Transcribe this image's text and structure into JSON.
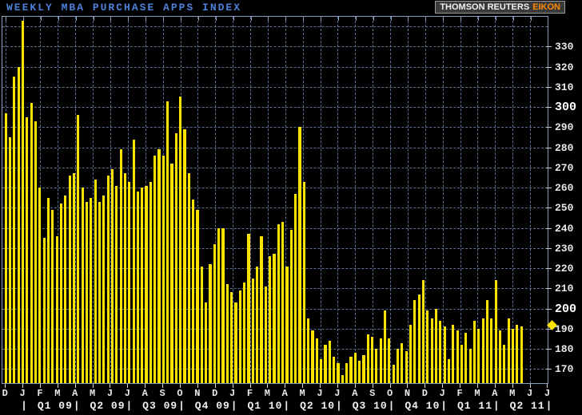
{
  "title_bar": {
    "title": "WEEKLY MBA PURCHASE APPS INDEX",
    "brand": {
      "name": "THOMSON REUTERS",
      "product": "EIKON"
    }
  },
  "chart_data": {
    "type": "bar",
    "title": "WEEKLY MBA PURCHASE APPS INDEX",
    "grid": "dashed",
    "legend_position": "none",
    "ylim": [
      164,
      345
    ],
    "y_ticks": [
      330,
      320,
      310,
      300,
      290,
      280,
      270,
      260,
      250,
      240,
      230,
      220,
      210,
      200,
      190,
      180,
      170
    ],
    "y_ticks_emphasized": [
      300,
      200
    ],
    "y_gridlines": [
      340,
      330,
      320,
      310,
      300,
      290,
      280,
      270,
      260,
      250,
      240,
      230,
      220,
      210,
      200,
      190,
      180,
      170
    ],
    "x_month_labels": [
      "D",
      "J",
      "F",
      "M",
      "A",
      "M",
      "J",
      "J",
      "A",
      "S",
      "O",
      "N",
      "D",
      "J",
      "F",
      "M",
      "A",
      "M",
      "J",
      "J",
      "A",
      "S",
      "O",
      "N",
      "D",
      "J",
      "F",
      "M",
      "A",
      "M",
      "J",
      "J"
    ],
    "x_quarter_labels": [
      "Q1 09",
      "Q2 09",
      "Q3 09",
      "Q4 09",
      "Q1 10",
      "Q2 10",
      "Q3 10",
      "Q4 10",
      "Q1 11",
      "Q2 11"
    ],
    "values": [
      298,
      286,
      316,
      321,
      344,
      296,
      303,
      294,
      261,
      236,
      256,
      250,
      237,
      253,
      257,
      267,
      268,
      297,
      261,
      254,
      256,
      265,
      254,
      257,
      267,
      270,
      262,
      280,
      268,
      264,
      285,
      259,
      261,
      262,
      264,
      277,
      280,
      277,
      304,
      273,
      288,
      306,
      290,
      268,
      255,
      250,
      222,
      204,
      223,
      233,
      241,
      241,
      213,
      209,
      204,
      210,
      214,
      238,
      216,
      222,
      237,
      212,
      227,
      228,
      243,
      244,
      222,
      240,
      258,
      291,
      264,
      196,
      190,
      186,
      176,
      183,
      185,
      177,
      174,
      168,
      174,
      177,
      179,
      175,
      178,
      188,
      187,
      181,
      186,
      200,
      186,
      173,
      181,
      184,
      180,
      193,
      205,
      208,
      215,
      200,
      196,
      201,
      195,
      192,
      176,
      193,
      190,
      183,
      189,
      181,
      195,
      191,
      196,
      205,
      196,
      215,
      190,
      183,
      196,
      191,
      193,
      192
    ],
    "latest_value_marker": 192,
    "colors": {
      "background": "#000000",
      "bar": "#ffe400",
      "grid": "#5e7090",
      "frame": "#8ca0bd",
      "title": "#4d80d8",
      "labels": "#e9e9ec",
      "eikon": "#ff8a00",
      "marker": "#ffe400"
    }
  }
}
